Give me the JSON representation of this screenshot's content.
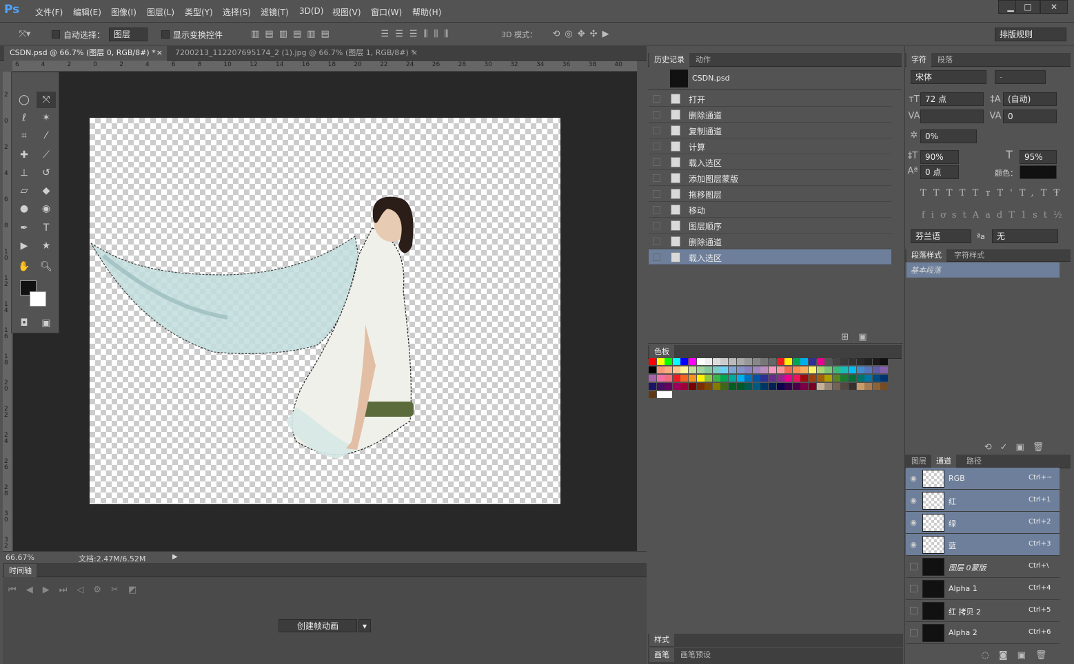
{
  "app": {
    "logo": "Ps"
  },
  "menu": [
    "文件(F)",
    "编辑(E)",
    "图像(I)",
    "图层(L)",
    "类型(Y)",
    "选择(S)",
    "滤镜(T)",
    "3D(D)",
    "视图(V)",
    "窗口(W)",
    "帮助(H)"
  ],
  "window": {
    "min": "▁",
    "max": "□",
    "close": "✕"
  },
  "options": {
    "auto_select_label": "自动选择：",
    "auto_select_value": "图层",
    "transform_label": "显示变换控件",
    "mode3d_label": "3D 模式：",
    "workspace": "排版规则"
  },
  "tabs": [
    {
      "label": "CSDN.psd @ 66.7% (图层 0, RGB/8#) *",
      "close": "×"
    },
    {
      "label": "7200213_112207695174_2 (1).jpg @ 66.7% (图层 1, RGB/8#) *",
      "close": "×"
    }
  ],
  "ruler_h": [
    "6",
    "4",
    "2",
    "0",
    "2",
    "4",
    "6",
    "8",
    "10",
    "12",
    "14",
    "16",
    "18",
    "20",
    "22",
    "24",
    "26",
    "28",
    "30",
    "32",
    "34",
    "36",
    "38",
    "40"
  ],
  "ruler_v": [
    "2",
    "0",
    "2",
    "4",
    "6",
    "8",
    "1 0",
    "1 2",
    "1 4",
    "1 6",
    "1 8",
    "2 0",
    "2 2",
    "2 4",
    "2 6",
    "2 8",
    "3 0",
    "3 2"
  ],
  "status": {
    "zoom": "66.67%",
    "doc": "文档:2.47M/6.52M"
  },
  "timeline": {
    "title": "时间轴",
    "create_button": "创建帧动画"
  },
  "history": {
    "tabs": [
      "历史记录",
      "动作"
    ],
    "snapshot": "CSDN.psd",
    "items": [
      "打开",
      "删除通道",
      "复制通道",
      "计算",
      "载入选区",
      "添加图层蒙版",
      "拖移图层",
      "移动",
      "图层顺序",
      "删除通道",
      "载入选区"
    ]
  },
  "swatches": {
    "tab": "色板",
    "colors": [
      "#ff0000",
      "#ffff00",
      "#00ff00",
      "#00ffff",
      "#0000ff",
      "#ff00ff",
      "#ffffff",
      "#eeeeee",
      "#dddddd",
      "#cccccc",
      "#bbbbbb",
      "#aaaaaa",
      "#999999",
      "#888888",
      "#777777",
      "#666666",
      "#ed1c24",
      "#fff200",
      "#00a651",
      "#00aeef",
      "#2e3192",
      "#ec008c",
      "#555555",
      "#444444",
      "#3a3a3a",
      "#333333",
      "#2a2a2a",
      "#222222",
      "#1a1a1a",
      "#111111",
      "#000000",
      "#f7977a",
      "#f9ad81",
      "#fdc68a",
      "#fff79a",
      "#c4df9b",
      "#a3d39c",
      "#82ca9d",
      "#7bcdc8",
      "#6ecff6",
      "#7ea7d8",
      "#8493ca",
      "#8882be",
      "#a187be",
      "#bc8dbf",
      "#f49ac2",
      "#f6989d",
      "#f26c4f",
      "#f68e55",
      "#fbaf5c",
      "#fff467",
      "#acd372",
      "#7cc576",
      "#3bb878",
      "#1abbb4",
      "#00bff3",
      "#438ccb",
      "#5574b9",
      "#605ca8",
      "#855fa8",
      "#a763a8",
      "#f06ea9",
      "#f26d7d",
      "#ed1c24",
      "#f26522",
      "#f7941d",
      "#fff200",
      "#8dc73f",
      "#39b54a",
      "#00a651",
      "#00a99d",
      "#00aeef",
      "#0072bc",
      "#0054a6",
      "#2e3192",
      "#662d91",
      "#92278f",
      "#ec008c",
      "#ed145b",
      "#9e0b0f",
      "#a0410d",
      "#a3620a",
      "#aba000",
      "#598527",
      "#1a7b30",
      "#007236",
      "#00746b",
      "#0076a3",
      "#004b80",
      "#003471",
      "#1b1464",
      "#440e62",
      "#630460",
      "#9e005d",
      "#9e0039",
      "#790000",
      "#7b2e00",
      "#7d4900",
      "#827b00",
      "#406618",
      "#005e20",
      "#005826",
      "#005952",
      "#005b7f",
      "#003663",
      "#002157",
      "#0d004c",
      "#32004b",
      "#4b0049",
      "#7b0046",
      "#7a0026",
      "#c7b299",
      "#998675",
      "#736357",
      "#534741",
      "#37302d",
      "#c69c6d",
      "#a67c52",
      "#8c6239",
      "#754c24",
      "#603913",
      "#ffffff",
      "#ffffff"
    ]
  },
  "character": {
    "tabs": [
      "字符",
      "段落"
    ],
    "font": "宋体",
    "style": "-",
    "size": "72 点",
    "leading": "(自动)",
    "tracking": "0",
    "tsume": "0%",
    "vscale": "90%",
    "hscale": "95%",
    "baseline": "0 点",
    "color_label": "颜色：",
    "type_buttons": [
      "T",
      "T",
      "TT",
      "Tт",
      "T'",
      "T,",
      "T",
      "Ŧ"
    ],
    "ot_buttons": [
      "fi",
      "ơ",
      "st",
      "A",
      "ad",
      "T",
      "1st",
      "½"
    ],
    "language": "芬兰语",
    "aa_label": "ªa",
    "antialias": "无"
  },
  "para_styles": {
    "tabs": [
      "段落样式",
      "字符样式"
    ],
    "item": "基本段落"
  },
  "channels": {
    "tabs": [
      "图层",
      "通道",
      "路径"
    ],
    "rows": [
      {
        "name": "RGB",
        "shortcut": "Ctrl+~",
        "selected": true,
        "visible": true
      },
      {
        "name": "红",
        "shortcut": "Ctrl+1",
        "selected": true,
        "visible": true
      },
      {
        "name": "绿",
        "shortcut": "Ctrl+2",
        "selected": true,
        "visible": true
      },
      {
        "name": "蓝",
        "shortcut": "Ctrl+3",
        "selected": true,
        "visible": true
      },
      {
        "name": "图层 0蒙版",
        "shortcut": "Ctrl+\\",
        "selected": false,
        "visible": false
      },
      {
        "name": "Alpha 1",
        "shortcut": "Ctrl+4",
        "selected": false,
        "visible": false
      },
      {
        "name": "红 拷贝 2",
        "shortcut": "Ctrl+5",
        "selected": false,
        "visible": false
      },
      {
        "name": "Alpha 2",
        "shortcut": "Ctrl+6",
        "selected": false,
        "visible": false
      }
    ]
  },
  "bottom_panels": {
    "styles": "样式",
    "brush": "画笔",
    "brush_presets": "画笔预设"
  },
  "icons": [
    "move-tool-icon",
    "marquee-icon",
    "lasso-icon",
    "magic-wand-icon",
    "crop-icon",
    "eyedropper-icon",
    "healing-icon",
    "brush-icon",
    "stamp-icon",
    "history-brush-icon",
    "eraser-icon",
    "paint-bucket-icon",
    "blur-icon",
    "dodge-icon",
    "pen-icon",
    "type-icon",
    "path-select-icon",
    "shape-icon",
    "hand-icon",
    "zoom-icon",
    "eye-icon",
    "trash-icon",
    "camera-icon",
    "new-icon"
  ]
}
